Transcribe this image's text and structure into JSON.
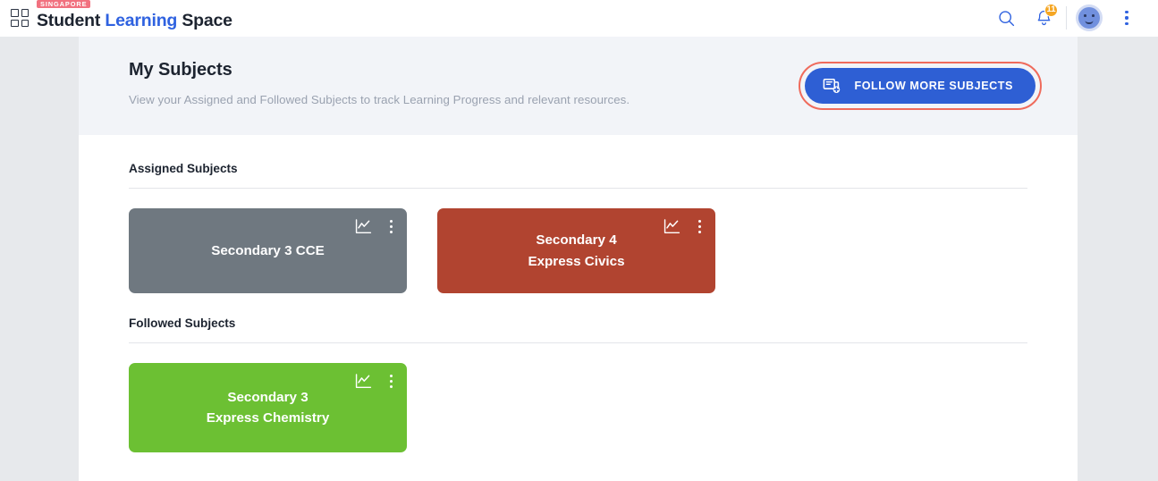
{
  "topbar": {
    "logo": {
      "badge": "SINGAPORE",
      "word1": "Student",
      "word2": "Learning",
      "word3": "Space",
      "grid_icon": "grid-apps-icon"
    },
    "search_icon": "search-icon",
    "notifications": {
      "icon": "bell-icon",
      "count": "11",
      "badge_color": "#f5a623"
    },
    "avatar": "user-avatar",
    "overflow_icon": "more-vertical-icon"
  },
  "header": {
    "title": "My Subjects",
    "subtitle": "View your Assigned and Followed Subjects to track Learning Progress and relevant resources.",
    "follow_button": {
      "label": "FOLLOW MORE SUBJECTS",
      "icon": "add-book-icon",
      "color": "#2e5fd4",
      "highlight_color": "#ef6b5c"
    }
  },
  "sections": [
    {
      "title": "Assigned Subjects",
      "cards": [
        {
          "title": "Secondary 3 CCE",
          "color": "#6f7880",
          "chart_icon": "progress-chart-icon",
          "menu_icon": "more-vertical-icon"
        },
        {
          "title": "Secondary 4\nExpress Civics",
          "color": "#b14430",
          "chart_icon": "progress-chart-icon",
          "menu_icon": "more-vertical-icon"
        }
      ]
    },
    {
      "title": "Followed Subjects",
      "cards": [
        {
          "title": "Secondary 3\nExpress Chemistry",
          "color": "#6cc033",
          "chart_icon": "progress-chart-icon",
          "menu_icon": "more-vertical-icon"
        }
      ]
    }
  ]
}
